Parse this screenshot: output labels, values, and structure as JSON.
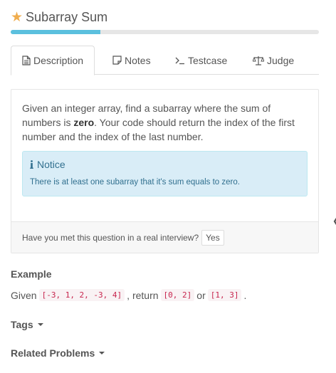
{
  "problem": {
    "title": "Subarray Sum",
    "progress_percent": 29
  },
  "tabs": [
    {
      "label": "Description",
      "icon": "file-text-icon"
    },
    {
      "label": "Notes",
      "icon": "note-icon"
    },
    {
      "label": "Testcase",
      "icon": "terminal-icon"
    },
    {
      "label": "Judge",
      "icon": "balance-scale-icon"
    }
  ],
  "description": {
    "text_before": "Given an integer array, find a subarray where the sum of numbers is ",
    "bold": "zero",
    "text_after": ". Your code should return the index of the first number and the index of the last number."
  },
  "notice": {
    "title": "Notice",
    "text": "There is at least one subarray that it's sum equals to zero."
  },
  "interview": {
    "question": "Have you met this question in a real interview?",
    "button": "Yes"
  },
  "example": {
    "heading": "Example",
    "given": "Given",
    "input": "[-3, 1, 2, -3, 4]",
    "return_word": ", return",
    "output1": "[0, 2]",
    "or_word": "or",
    "output2": "[1, 3]",
    "end": "."
  },
  "tags_label": "Tags",
  "related_label": "Related Problems",
  "colors": {
    "star": "#f0ad4e",
    "progress": "#5bc0de",
    "notice_bg": "#d9edf7",
    "notice_text": "#31708f",
    "code_text": "#c7254e"
  }
}
